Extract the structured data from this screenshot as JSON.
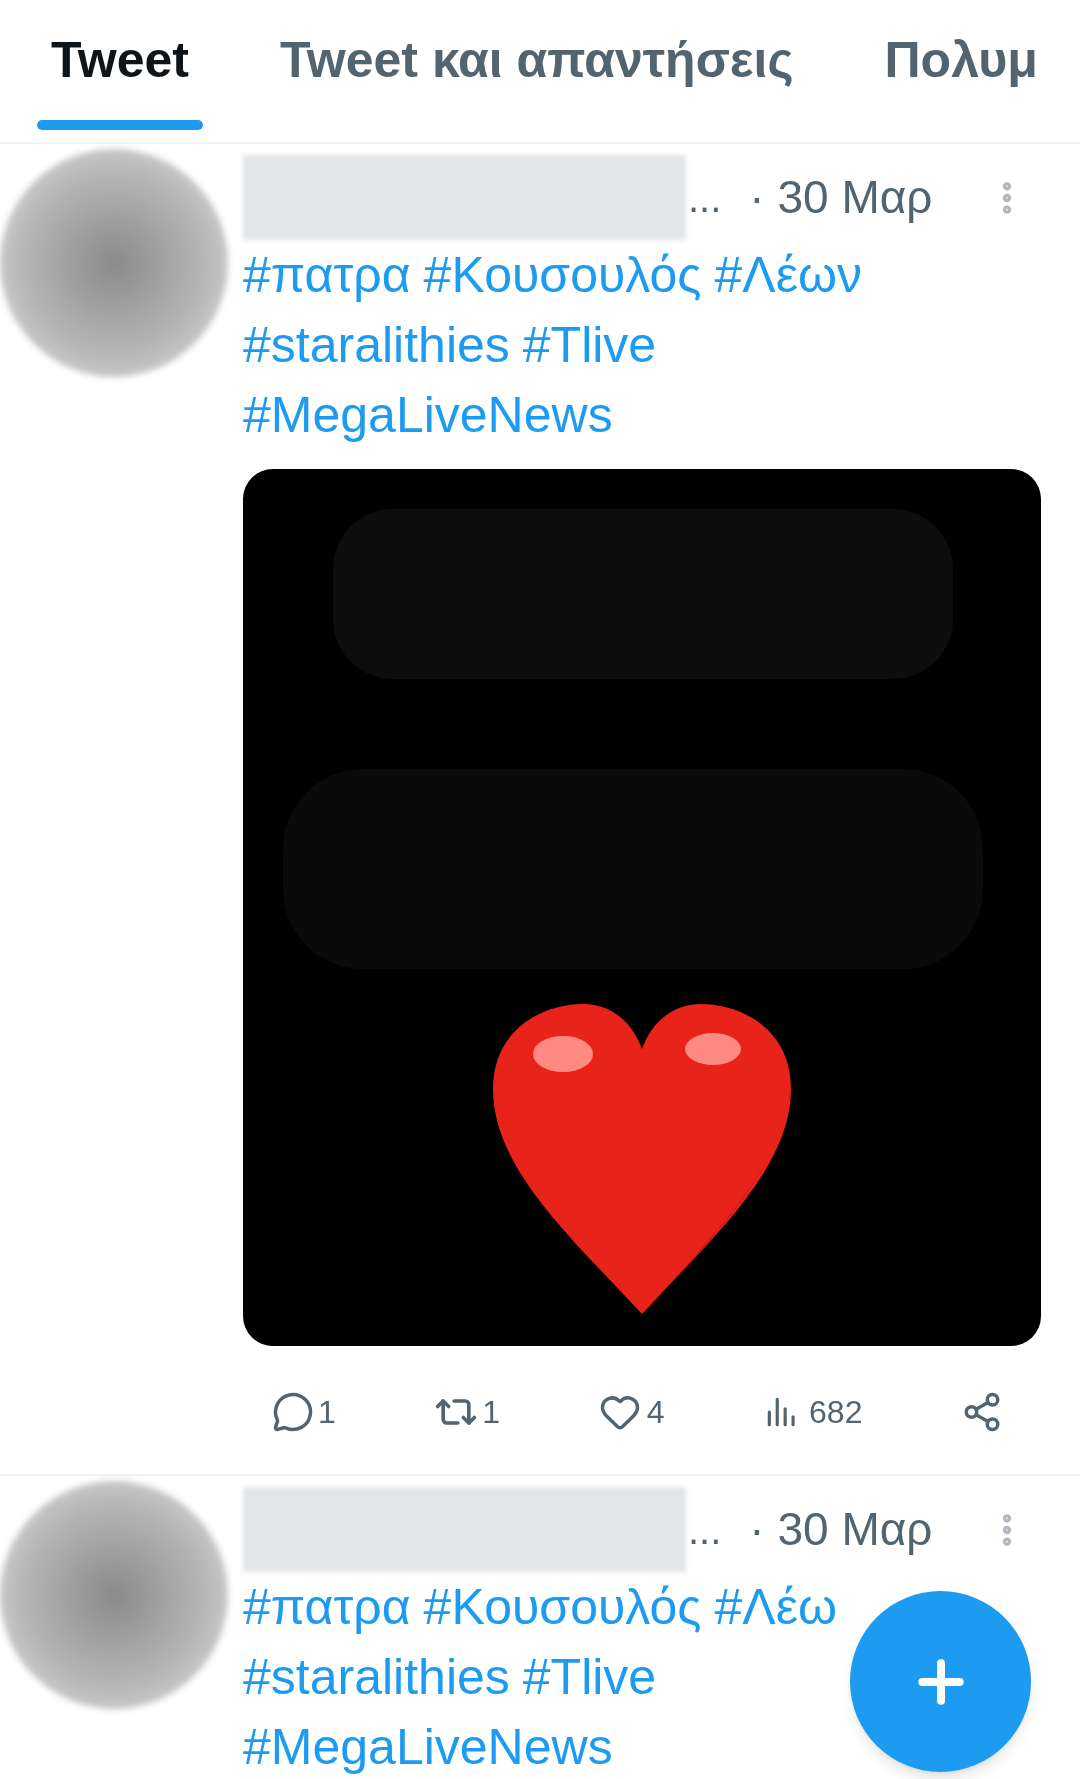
{
  "tabs": [
    {
      "label": "Tweet",
      "selected": true
    },
    {
      "label": "Tweet και απαντήσεις",
      "selected": false
    },
    {
      "label": "Πολυμ",
      "selected": false
    }
  ],
  "tweets": [
    {
      "name_suffix": "...",
      "date": "· 30 Μαρ",
      "hashtag_lines": [
        [
          "#πατρα",
          "#Κουσουλός",
          "#Λέων"
        ],
        [
          "#staralithies",
          "#Tlive"
        ],
        [
          "#MegaLiveNews"
        ]
      ],
      "media": {
        "kind": "picture"
      },
      "stats": {
        "replies": "1",
        "retweets": "1",
        "likes": "4",
        "views": "682"
      }
    },
    {
      "name_suffix": "...",
      "date": "· 30 Μαρ",
      "hashtag_lines": [
        [
          "#πατρα",
          "#Κουσουλός",
          "#Λέω"
        ],
        [
          "#staralithies",
          "#Tlive"
        ],
        [
          "#MegaLiveNews"
        ]
      ]
    }
  ]
}
